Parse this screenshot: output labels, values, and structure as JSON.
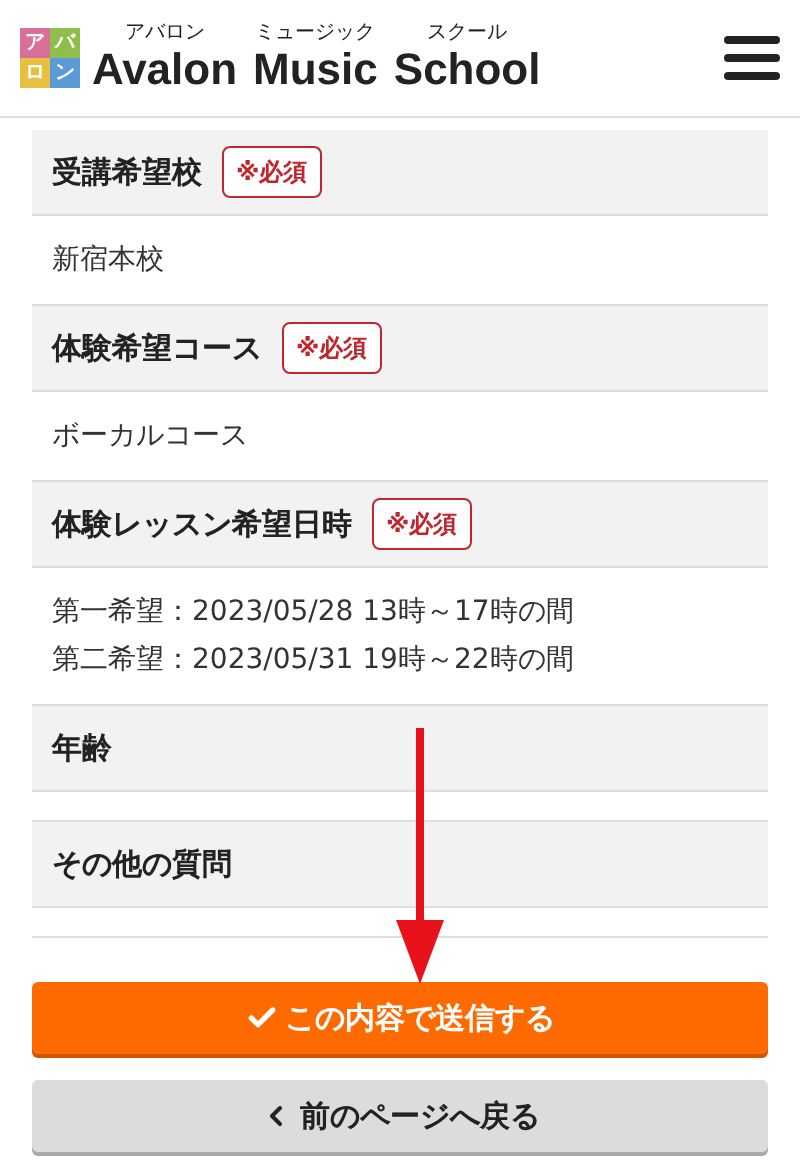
{
  "header": {
    "logo_cells": [
      {
        "text": "ア",
        "color": "#d9709a"
      },
      {
        "text": "バ",
        "color": "#8fbf4a"
      },
      {
        "text": "ロ",
        "color": "#e8c040"
      },
      {
        "text": "ン",
        "color": "#5a9ad6"
      }
    ],
    "title_words": [
      {
        "ruby": "アバロン",
        "text": "Avalon"
      },
      {
        "ruby": "ミュージック",
        "text": "Music"
      },
      {
        "ruby": "スクール",
        "text": "School"
      }
    ]
  },
  "sections": [
    {
      "label": "受講希望校",
      "required": true,
      "badge": "※必須",
      "values": [
        "新宿本校"
      ]
    },
    {
      "label": "体験希望コース",
      "required": true,
      "badge": "※必須",
      "values": [
        "ボーカルコース"
      ]
    },
    {
      "label": "体験レッスン希望日時",
      "required": true,
      "badge": "※必須",
      "values": [
        "第一希望：2023/05/28 13時～17時の間",
        "第二希望：2023/05/31 19時～22時の間"
      ]
    },
    {
      "label": "年齢",
      "required": false
    },
    {
      "label": "その他の質問",
      "required": false
    }
  ],
  "buttons": {
    "submit": "この内容で送信する",
    "back": "前のページへ戻る"
  }
}
